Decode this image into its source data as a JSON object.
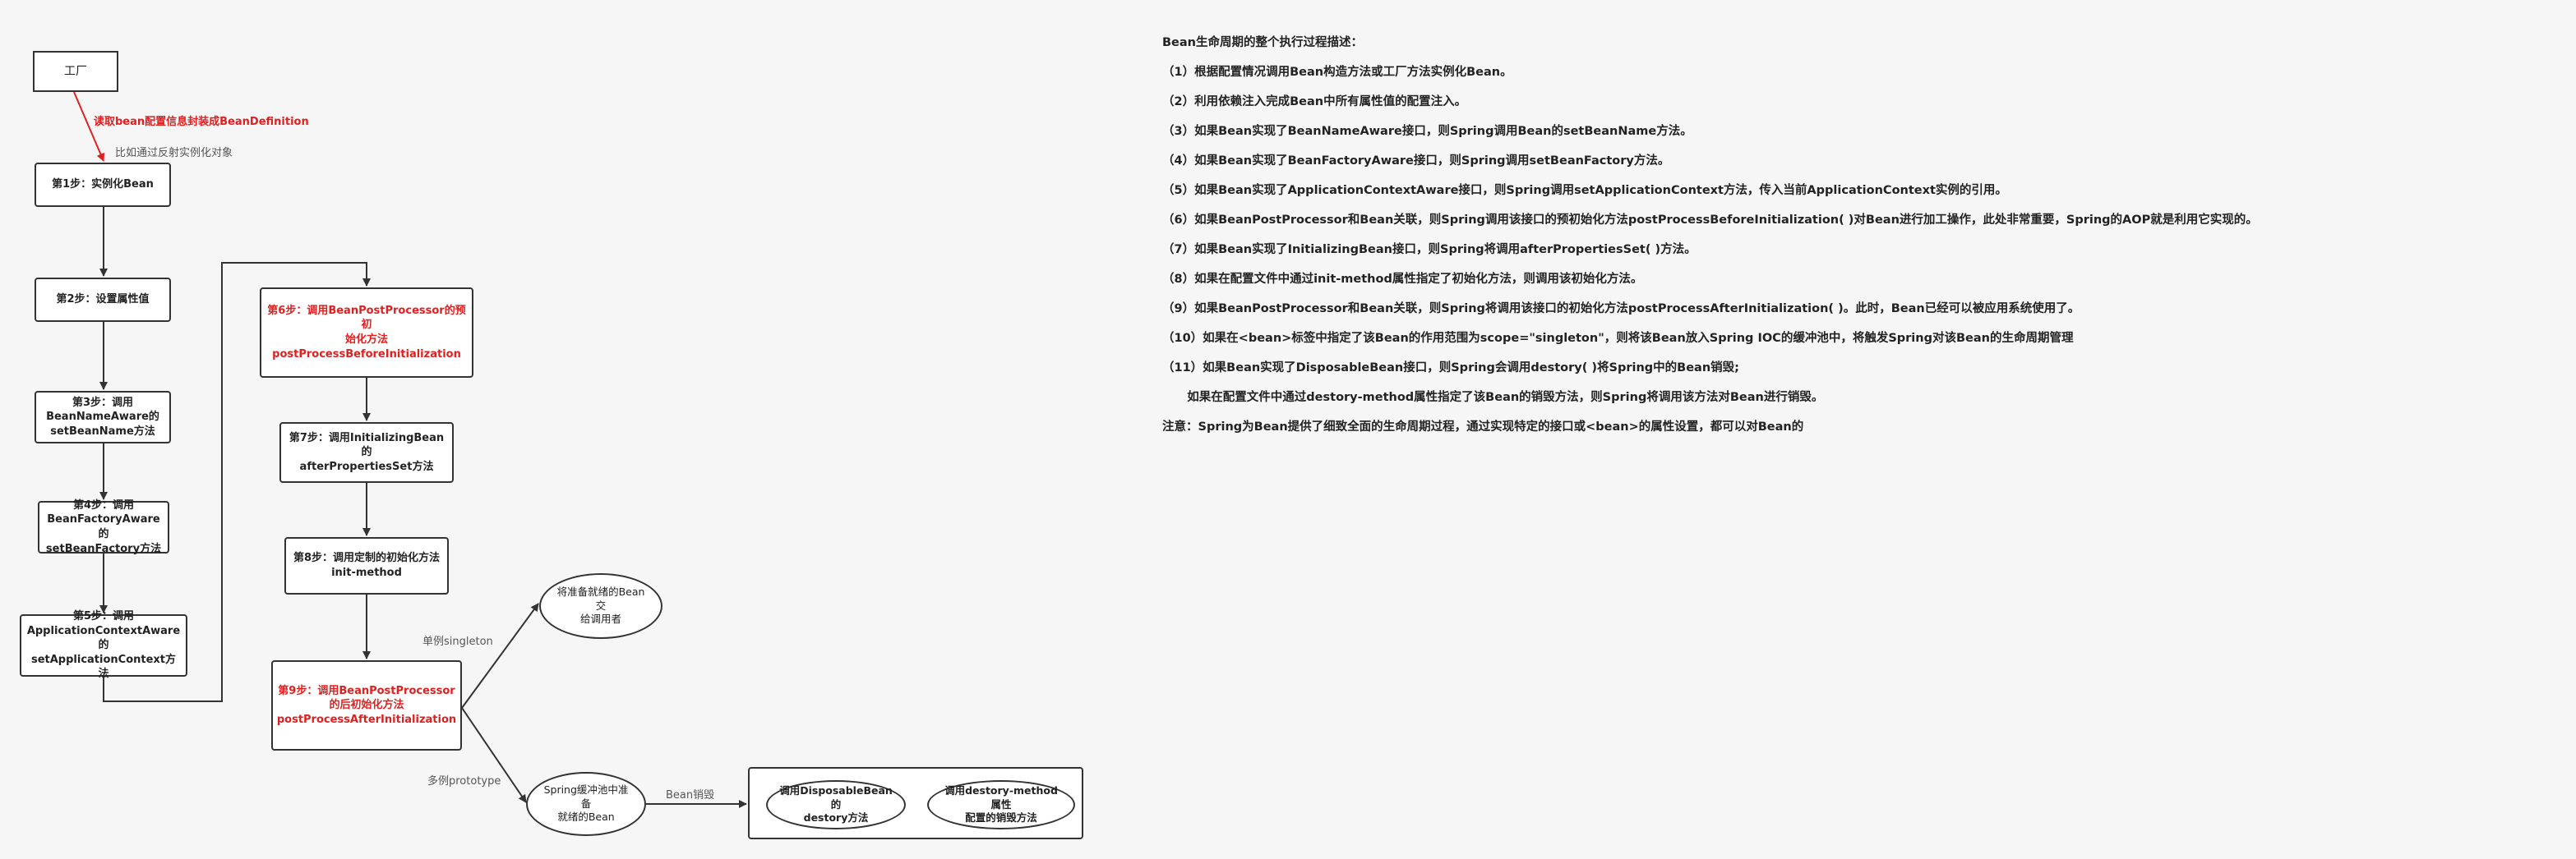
{
  "diagram": {
    "factory": "工厂",
    "edge_factory_red": "读取bean配置信息封装成BeanDefinition",
    "edge_factory_gray": "比如通过反射实例化对象",
    "step1": "第1步：实例化Bean",
    "step2": "第2步：设置属性值",
    "step3": "第3步：调用\nBeanNameAware的\nsetBeanName方法",
    "step4": "第4步：调用\nBeanFactoryAware的\nsetBeanFactory方法",
    "step5": "第5步：调用\nApplicationContextAware的\nsetApplicationContext方法",
    "step6": "第6步：调用BeanPostProcessor的预初\n始化方法\npostProcessBeforeInitialization",
    "step7": "第7步：调用InitializingBean的\nafterPropertiesSet方法",
    "step8": "第8步：调用定制的初始化方法\ninit-method",
    "step9": "第9步：调用BeanPostProcessor\n的后初始化方法\npostProcessAfterInitialization",
    "singleton_label": "单例singleton",
    "prototype_label": "多例prototype",
    "singleton_ellipse": "将准备就绪的Bean交\n给调用者",
    "prototype_ellipse": "Spring缓冲池中准备\n就绪的Bean",
    "destroy_label": "Bean销毁",
    "destroy1": "调用DisposableBean的\ndestory方法",
    "destroy2": "调用destory-method属性\n配置的销毁方法"
  },
  "description": {
    "title": "Bean生命周期的整个执行过程描述：",
    "lines": [
      "（1）根据配置情况调用Bean构造方法或工厂方法实例化Bean。",
      "（2）利用依赖注入完成Bean中所有属性值的配置注入。",
      "（3）如果Bean实现了BeanNameAware接口，则Spring调用Bean的setBeanName方法。",
      "（4）如果Bean实现了BeanFactoryAware接口，则Spring调用setBeanFactory方法。",
      "（5）如果Bean实现了ApplicationContextAware接口，则Spring调用setApplicationContext方法，传入当前ApplicationContext实例的引用。",
      "（6）如果BeanPostProcessor和Bean关联，则Spring调用该接口的预初始化方法postProcessBeforeInitialization( )对Bean进行加工操作，此处非常重要，Spring的AOP就是利用它实现的。",
      "（7）如果Bean实现了InitializingBean接口，则Spring将调用afterPropertiesSet( )方法。",
      "（8）如果在配置文件中通过init-method属性指定了初始化方法，则调用该初始化方法。",
      "（9）如果BeanPostProcessor和Bean关联，则Spring将调用该接口的初始化方法postProcessAfterInitialization( )。此时，Bean已经可以被应用系统使用了。",
      "（10）如果在<bean>标签中指定了该Bean的作用范围为scope=\"singleton\"，则将该Bean放入Spring IOC的缓冲池中，将触发Spring对该Bean的生命周期管理",
      "（11）如果Bean实现了DisposableBean接口，则Spring会调用destory( )将Spring中的Bean销毁;",
      "      如果在配置文件中通过destory-method属性指定了该Bean的销毁方法，则Spring将调用该方法对Bean进行销毁。",
      "注意：Spring为Bean提供了细致全面的生命周期过程，通过实现特定的接口或<bean>的属性设置，都可以对Bean的"
    ]
  },
  "colors": {
    "accent": "#e02020",
    "line": "#333333"
  }
}
